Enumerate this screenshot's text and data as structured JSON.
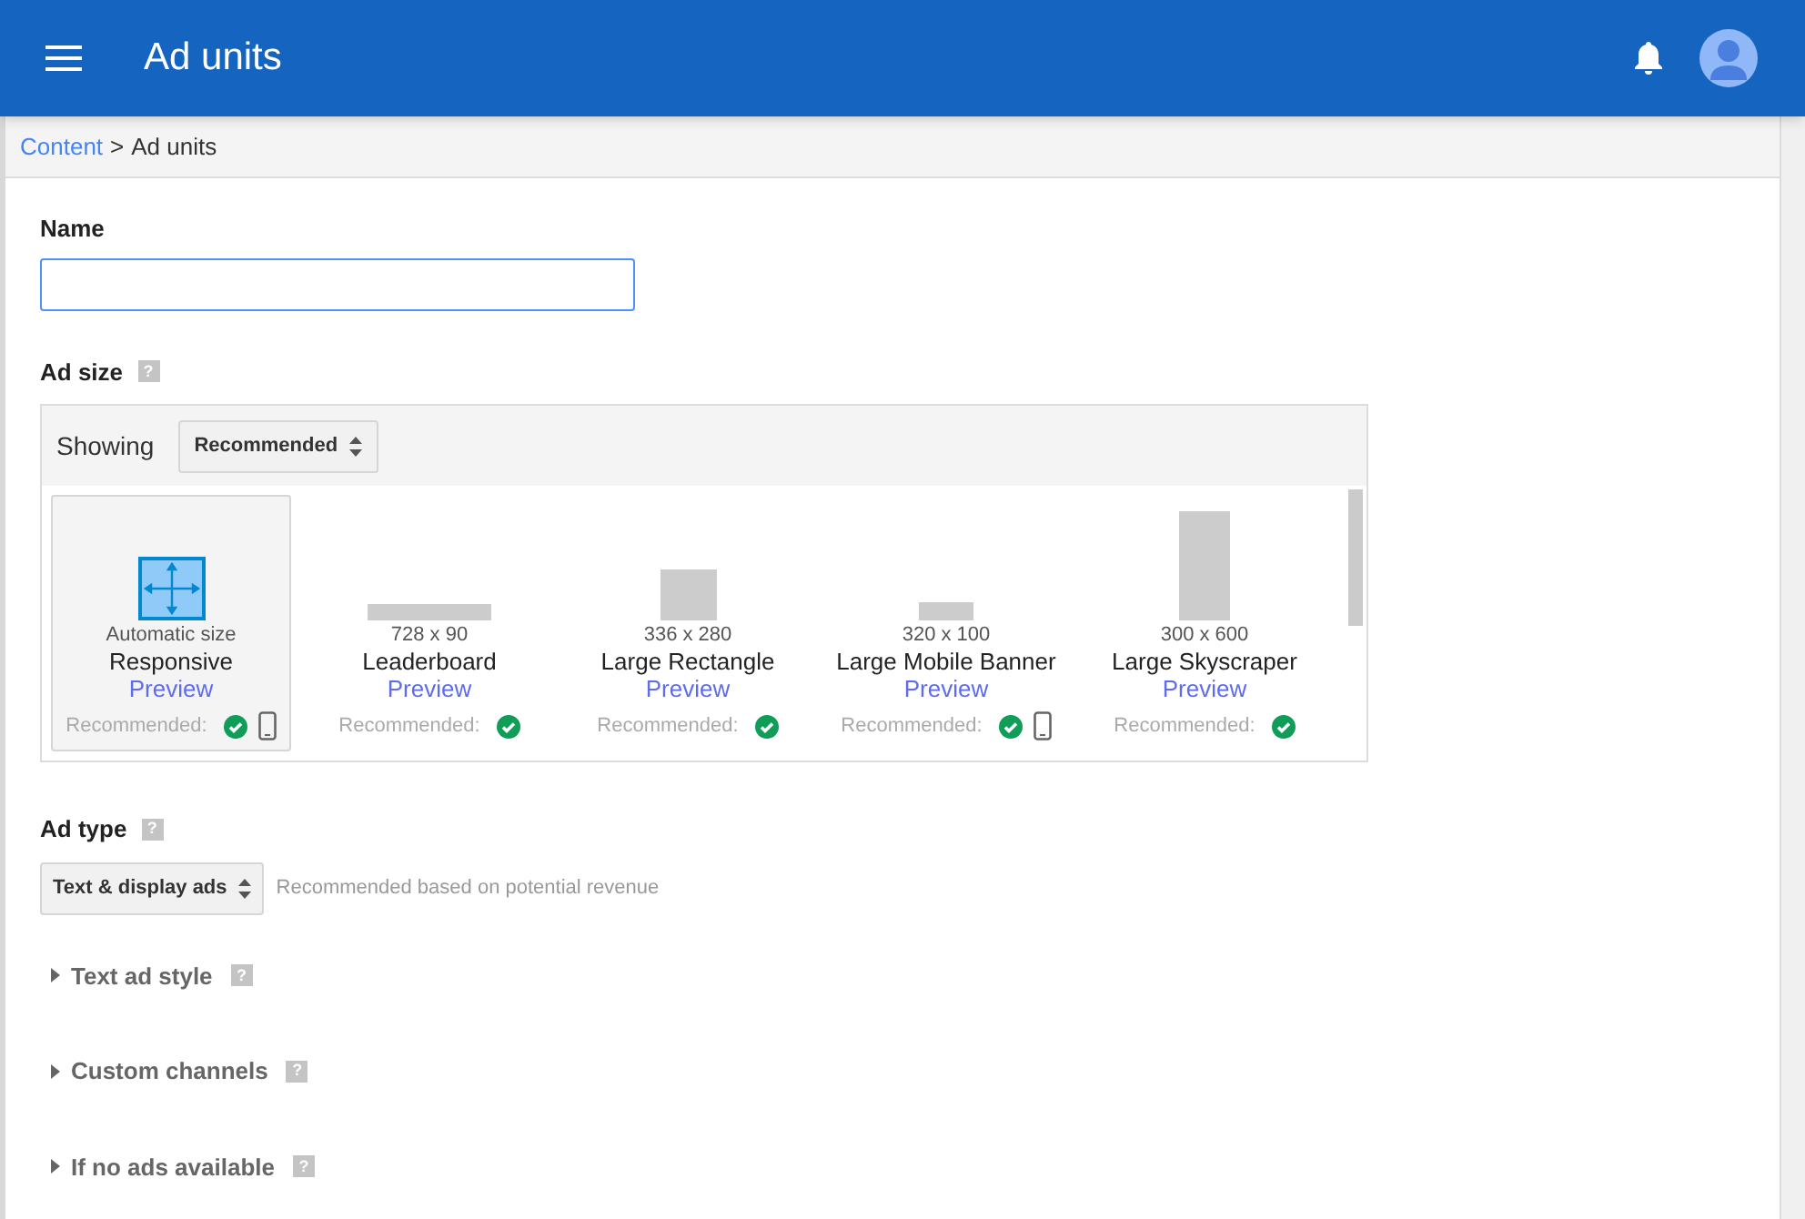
{
  "app_bar": {
    "title": "Ad units"
  },
  "breadcrumb": {
    "link": "Content",
    "separator": ">",
    "current": "Ad units"
  },
  "name_field": {
    "label": "Name"
  },
  "ad_size": {
    "label": "Ad size",
    "help": "?",
    "showing_label": "Showing",
    "filter": "Recommended",
    "sizes": [
      {
        "kind": "responsive",
        "caption": "Automatic size",
        "name": "Responsive",
        "preview": "Preview",
        "recommended": "Recommended:",
        "mobile": true,
        "selected": true
      },
      {
        "kind": "fixed",
        "caption": "728 x 90",
        "name": "Leaderboard",
        "preview": "Preview",
        "recommended": "Recommended:",
        "mobile": false,
        "selected": false
      },
      {
        "kind": "fixed",
        "caption": "336 x 280",
        "name": "Large Rectangle",
        "preview": "Preview",
        "recommended": "Recommended:",
        "mobile": false,
        "selected": false
      },
      {
        "kind": "fixed",
        "caption": "320 x 100",
        "name": "Large Mobile Banner",
        "preview": "Preview",
        "recommended": "Recommended:",
        "mobile": true,
        "selected": false
      },
      {
        "kind": "fixed",
        "caption": "300 x 600",
        "name": "Large Skyscraper",
        "preview": "Preview",
        "recommended": "Recommended:",
        "mobile": false,
        "selected": false
      }
    ]
  },
  "ad_type": {
    "label": "Ad type",
    "help": "?",
    "value": "Text & display ads",
    "note": "Recommended based on potential revenue"
  },
  "sections": [
    {
      "label": "Text ad style",
      "help": "?",
      "expanded": false
    },
    {
      "label": "Custom channels",
      "help": "?",
      "expanded": false
    },
    {
      "label": "If no ads available",
      "help": "?",
      "expanded": false
    }
  ]
}
